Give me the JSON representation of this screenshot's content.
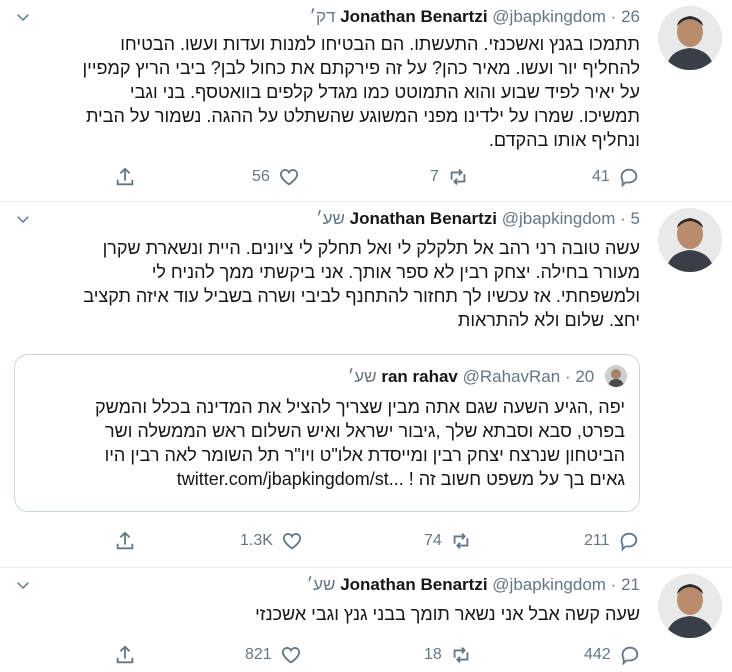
{
  "tweets": [
    {
      "name": "Jonathan Benartzi",
      "handle": "@jbapkingdom",
      "dot": "·",
      "time": "26 דק׳",
      "text": "תתמכו בגנץ ואשכנזי. התעשתו. הם הבטיחו למנות ועדות ועשו. הבטיחו\nלהחליף יור ועשו. מאיר כהן? על זה פירקתם את כחול לבן? ביבי הריץ קמפיין\nעל יאיר לפיד שבוע והוא התמוטט כמו מגדל קלפים בוואטסף. בני וגבי\nתמשיכו. שמרו על ילדינו מפני המשוגע שהשתלט על ההגה. נשמור על הבית\nונחליף אותו בהקדם.",
      "replies": "41",
      "retweets": "7",
      "likes": "56"
    },
    {
      "name": "Jonathan Benartzi",
      "handle": "@jbapkingdom",
      "dot": "·",
      "time": "5 שע׳",
      "text": "עשה טובה רני רהב אל תלקלק לי ואל תחלק לי ציונים. היית ונשארת שקרן\nמעורר בחילה. יצחק רבין לא ספר אותך. אני ביקשתי ממך להניח לי\nולמשפחתי. אז עכשיו לך תחזור להתחנף לביבי ושרה בשביל עוד איזה תקציב\nיחצ. שלום ולא להתראות",
      "quote": {
        "name": "ran rahav",
        "handle": "@RahavRan",
        "dot": "·",
        "time": "20 שע׳",
        "text": "יפה ,הגיע השעה שגם אתה מבין שצריך להציל את המדינה בכלל והמשק\nבפרט, סבא וסבתא שלך ,גיבור ישראל ואיש השלום ראש הממשלה ושר\nהביטחון שנרצח יצחק רבין  ומייסדת אלו\"ט ויו\"ר תל השומר לאה רבין היו\nגאים בך על משפט חשוב זה ! ...",
        "link": "twitter.com/jbapkingdom/st"
      },
      "replies": "211",
      "retweets": "74",
      "likes": "1.3K"
    },
    {
      "name": "Jonathan Benartzi",
      "handle": "@jbapkingdom",
      "dot": "·",
      "time": "21 שע׳",
      "text": "שעה קשה אבל אני נשאר תומך בבני גנץ וגבי אשכנזי",
      "replies": "442",
      "retweets": "18",
      "likes": "821"
    }
  ],
  "colors": {
    "text": "#14171a",
    "muted": "#657786",
    "border": "#e6ecf0"
  },
  "icons": {
    "reply": "reply-icon",
    "retweet": "retweet-icon",
    "like": "heart-icon",
    "share": "share-icon",
    "more": "chevron-down-icon"
  }
}
